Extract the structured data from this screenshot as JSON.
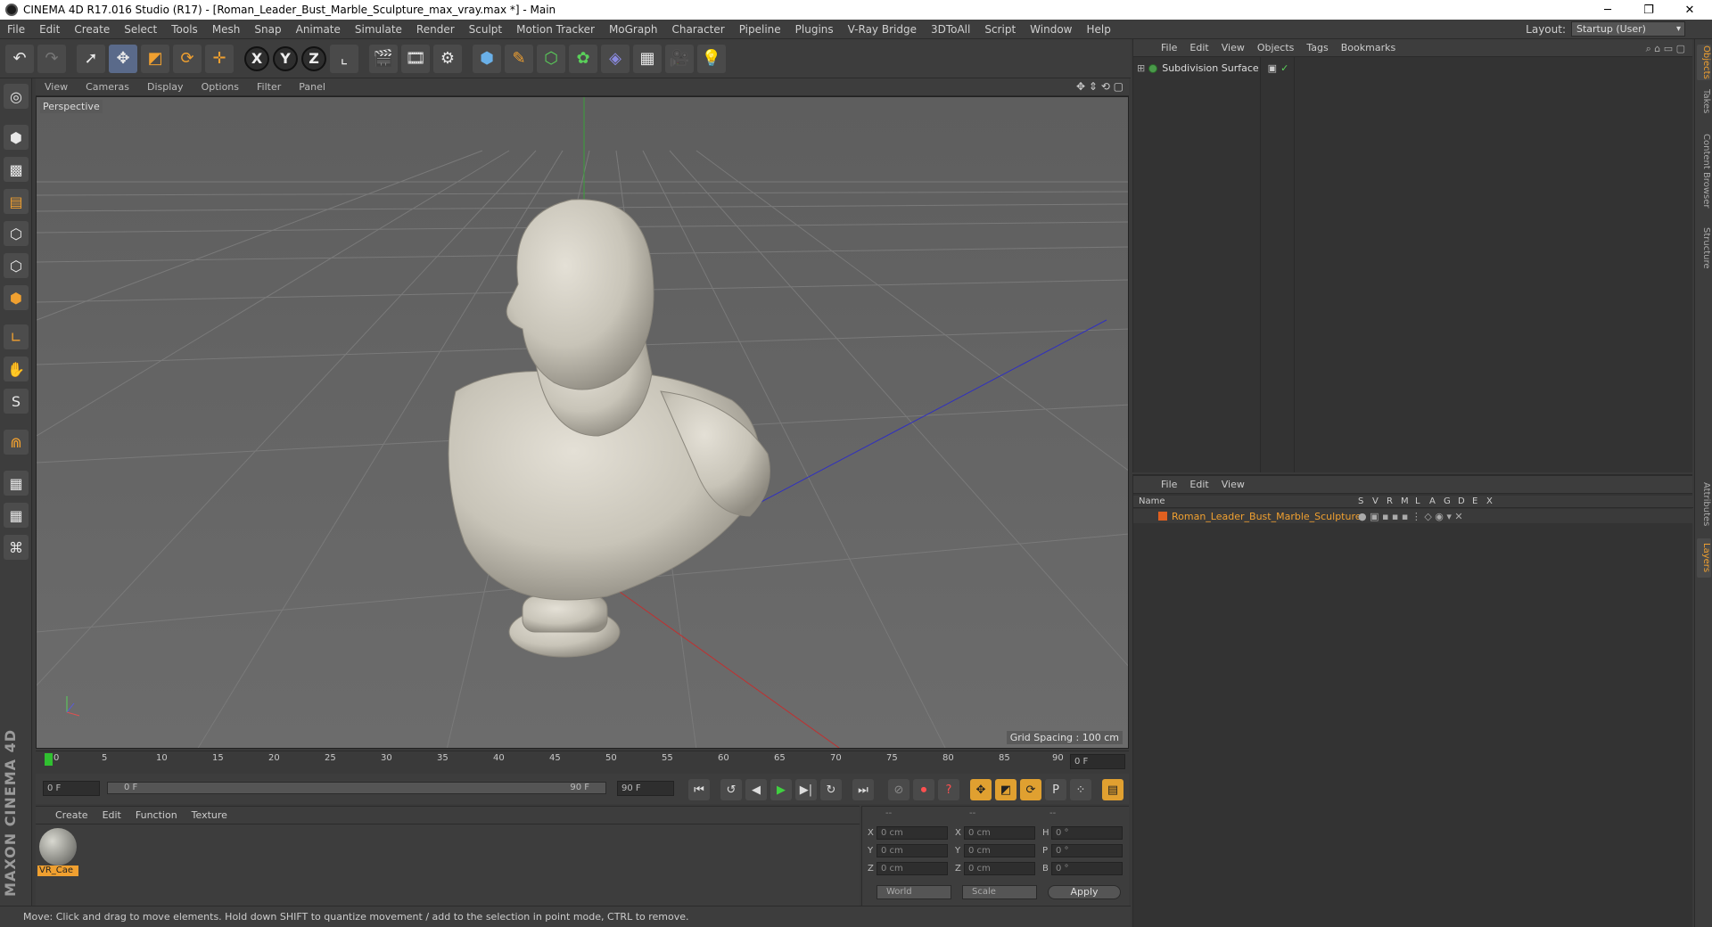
{
  "window": {
    "title": "CINEMA 4D R17.016 Studio (R17) - [Roman_Leader_Bust_Marble_Sculpture_max_vray.max *] - Main",
    "minimize": "─",
    "restore": "❐",
    "close": "✕"
  },
  "menubar": {
    "items": [
      "File",
      "Edit",
      "Create",
      "Select",
      "Tools",
      "Mesh",
      "Snap",
      "Animate",
      "Simulate",
      "Render",
      "Sculpt",
      "Motion Tracker",
      "MoGraph",
      "Character",
      "Pipeline",
      "Plugins",
      "V-Ray Bridge",
      "3DToAll",
      "Script",
      "Window",
      "Help"
    ],
    "layout_label": "Layout:",
    "layout_value": "Startup (User)"
  },
  "viewport": {
    "menu": [
      "View",
      "Cameras",
      "Display",
      "Options",
      "Filter",
      "Panel"
    ],
    "label": "Perspective",
    "grid_spacing": "Grid Spacing : 100 cm"
  },
  "timeline": {
    "ticks": [
      "0",
      "5",
      "10",
      "15",
      "20",
      "25",
      "30",
      "35",
      "40",
      "45",
      "50",
      "55",
      "60",
      "65",
      "70",
      "75",
      "80",
      "85",
      "90"
    ],
    "current_frame": "0 F",
    "start_field": "0 F",
    "range_start": "0 F",
    "range_end": "90 F",
    "end_field": "90 F"
  },
  "material_manager": {
    "menu": [
      "Create",
      "Edit",
      "Function",
      "Texture"
    ],
    "material_name": "VR_Cae"
  },
  "coordinates": {
    "headers": [
      "--",
      "--",
      "--"
    ],
    "rows": [
      {
        "a": "X",
        "av": "0 cm",
        "b": "X",
        "bv": "0 cm",
        "c": "H",
        "cv": "0 °"
      },
      {
        "a": "Y",
        "av": "0 cm",
        "b": "Y",
        "bv": "0 cm",
        "c": "P",
        "cv": "0 °"
      },
      {
        "a": "Z",
        "av": "0 cm",
        "b": "Z",
        "bv": "0 cm",
        "c": "B",
        "cv": "0 °"
      }
    ],
    "world": "World",
    "scale": "Scale",
    "apply": "Apply"
  },
  "status": {
    "text": "Move: Click and drag to move elements. Hold down SHIFT to quantize movement / add to the selection in point mode, CTRL to remove."
  },
  "object_manager": {
    "menu": [
      "File",
      "Edit",
      "View",
      "Objects",
      "Tags",
      "Bookmarks"
    ],
    "object": "Subdivision Surface"
  },
  "layer_manager": {
    "menu": [
      "File",
      "Edit",
      "View"
    ],
    "columns": [
      "Name",
      "S",
      "V",
      "R",
      "M",
      "L",
      "A",
      "G",
      "D",
      "E",
      "X"
    ],
    "layer": "Roman_Leader_Bust_Marble_Sculpture"
  },
  "sidetabs": [
    "Objects",
    "Takes",
    "Content Browser",
    "Structure",
    "Attributes",
    "Layers"
  ],
  "branding": "MAXON CINEMA 4D"
}
